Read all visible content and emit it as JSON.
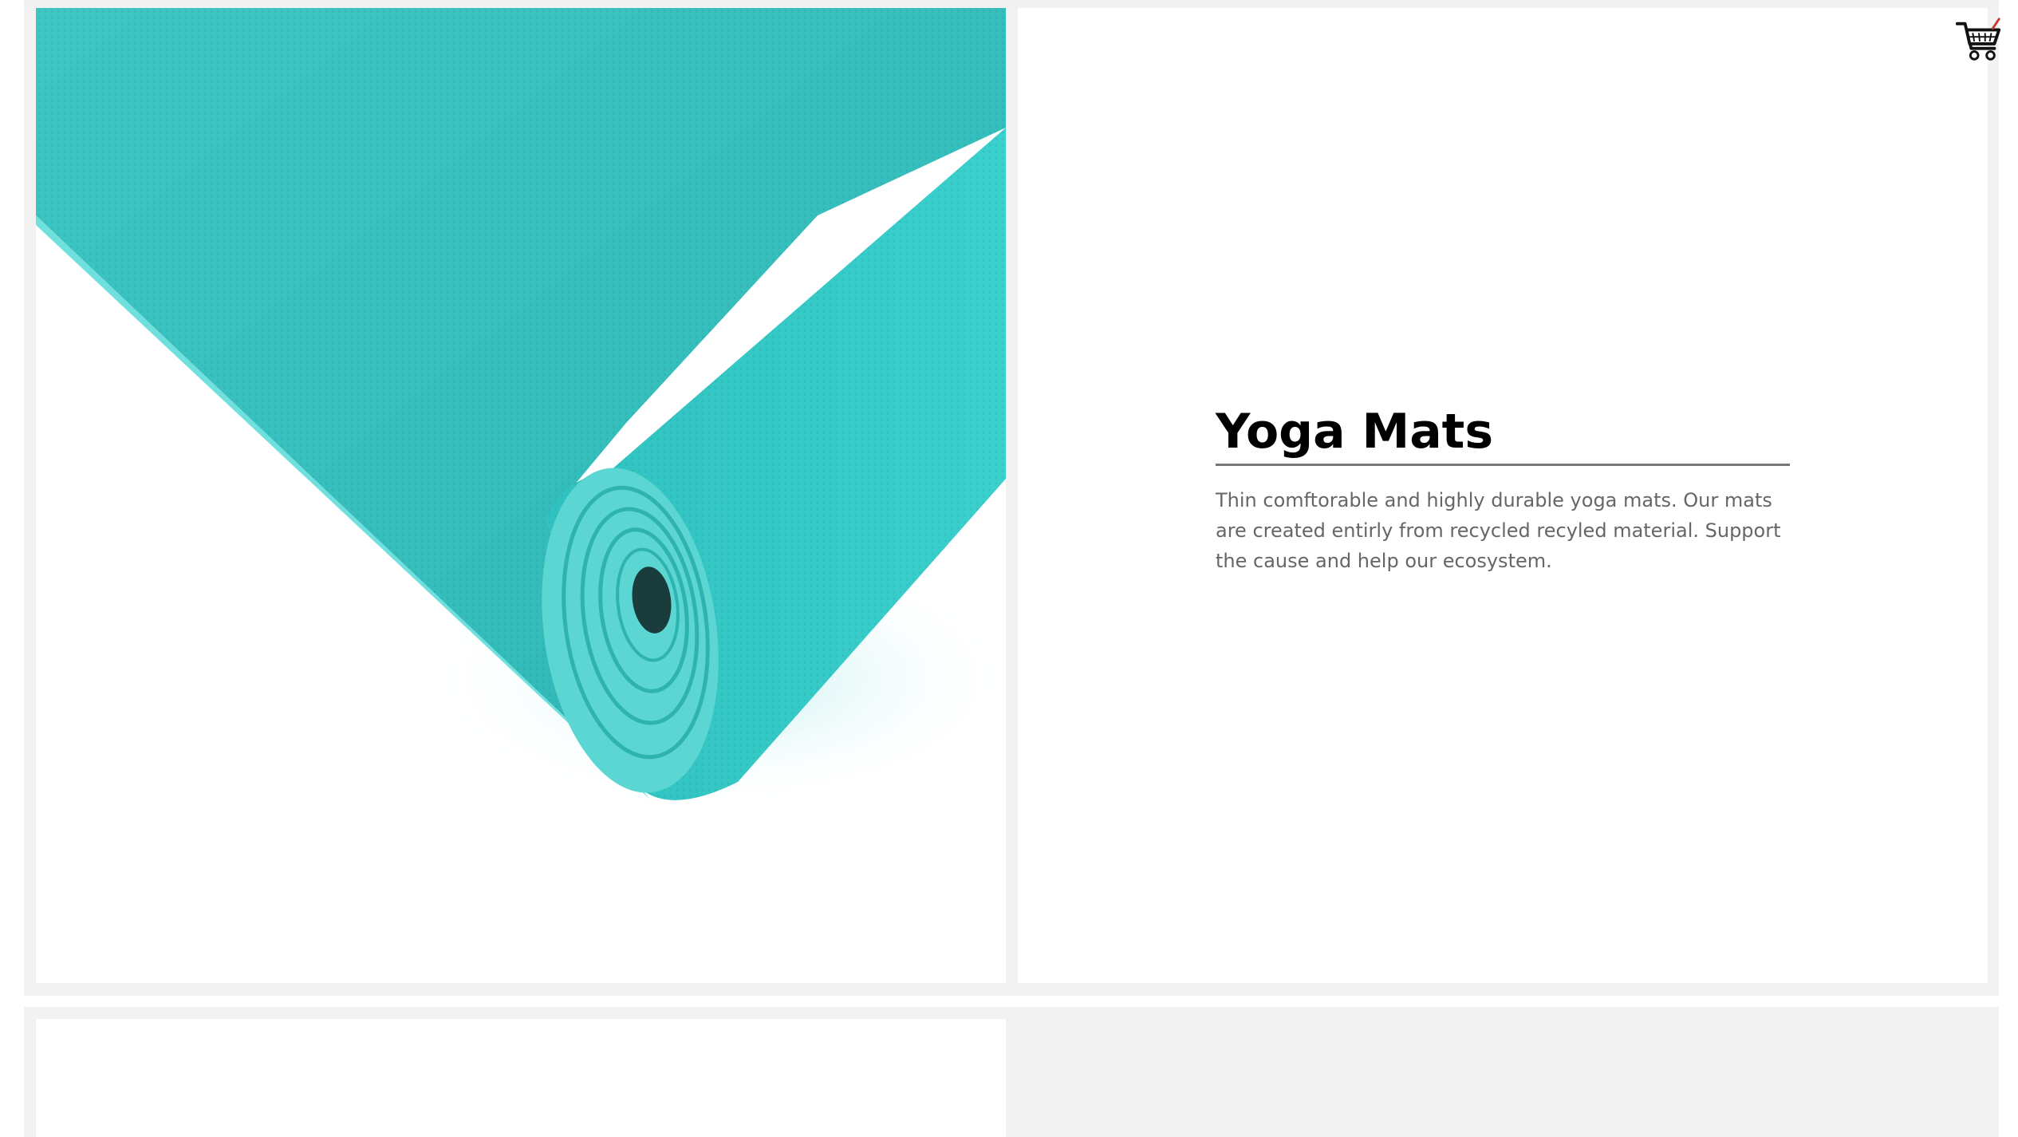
{
  "product": {
    "title": "Yoga Mats",
    "description": "Thin comftorable and highly durable yoga mats. Our mats are created entirly from recycled recyled material. Support the cause and help our ecosystem."
  },
  "colors": {
    "mat": "#35c4c2",
    "background": "#f2f2f2",
    "text_secondary": "#666666"
  },
  "icons": {
    "cart": "shopping-cart-icon"
  }
}
